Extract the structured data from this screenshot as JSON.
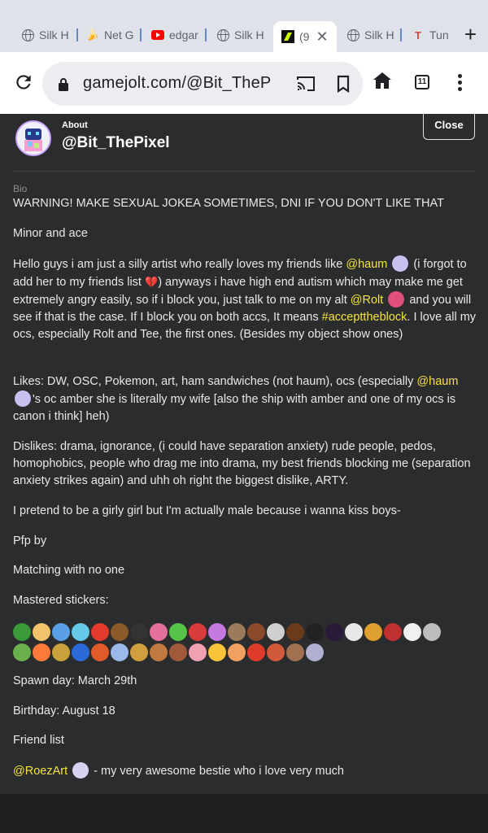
{
  "browser": {
    "tabs": [
      {
        "label": "Silk H",
        "icon": "globe-icon"
      },
      {
        "label": "Net G",
        "icon": "banana-icon"
      },
      {
        "label": "edgar",
        "icon": "youtube-icon"
      },
      {
        "label": "Silk H",
        "icon": "globe-icon"
      },
      {
        "label": "(9",
        "icon": "gamejolt-icon",
        "active": true
      },
      {
        "label": "Silk H",
        "icon": "globe-icon"
      },
      {
        "label": "Tun",
        "icon": "tumblr-icon"
      }
    ],
    "url": "gamejolt.com/@Bit_TheP",
    "tab_count": "11"
  },
  "modal": {
    "section": "About",
    "username": "@Bit_ThePixel",
    "close_label": "Close",
    "bio_label": "Bio",
    "lines": {
      "warning": "WARNING! MAKE SEXUAL JOKEA SOMETIMES, DNI IF YOU DON'T LIKE THAT",
      "minor": "Minor and ace",
      "p1a": "Hello guys i am just a silly artist who really loves my friends like ",
      "p1_mention1": "@haum",
      "p1b": " (i forgot to add her to my friends list ",
      "p1_emoji": "💔",
      "p1c": ") anyways i have high end autism which may make me get extremely angry easily, so if i block you, just talk to me on my alt ",
      "p1_mention2": "@Rolt",
      "p1d": " and you will see if that is the case. If I block you on both accs, It means ",
      "p1_hashtag": "#accepttheblock",
      "p1e": ". I love all my ocs, especially Rolt and Tee, the first ones. (Besides my object show ones)",
      "likes_a": "Likes: DW, OSC, Pokemon, art, ham sandwiches (not haum), ocs (especially ",
      "likes_mention": "@haum",
      "likes_b": "'s oc amber she is literally my wife [also the ship with amber and one of my ocs is canon i think] heh)",
      "dislikes": "Dislikes: drama, ignorance, (i could have separation anxiety) rude people, pedos, homophobics, people who drag me into drama, my best friends blocking me (separation anxiety strikes again) and uhh oh right the biggest dislike, ARTY.",
      "pretend": "I pretend to be a girly girl but I'm actually male because i wanna kiss boys-",
      "pfp": "Pfp by",
      "matching": "Matching with no one",
      "mastered": "Mastered stickers:",
      "spawn": "Spawn day: March 29th",
      "birthday": "Birthday: August 18",
      "friends": "Friend list",
      "bestie_mention": "@RoezArt",
      "bestie_text": " - my very awesome bestie who i love very much"
    },
    "stickers_row1": [
      "#3a9a3a",
      "#f3c36b",
      "#5aa0e6",
      "#66c9e8",
      "#e33b2e",
      "#8b5a2b",
      "#333333",
      "#e36f9c",
      "#57c24a",
      "#d93a3a",
      "#c479e0",
      "#9c7b5a",
      "#8a4a2a",
      "#cfcfcf",
      "#6a3a1a",
      "#222222",
      "#2a1a3a",
      "#e8e8e8",
      "#e0a030",
      "#c03030",
      "#f0f0f0",
      "#bdbdbd"
    ],
    "stickers_row2": [
      "#6ab04c",
      "#ff7a3a",
      "#c9a03a",
      "#2a6ad8",
      "#e05a2a",
      "#9ab8e8",
      "#d0a040",
      "#c07a40",
      "#a05a3a",
      "#f0a0b0",
      "#f8c43a",
      "#f0a060",
      "#e03a2a",
      "#d05a3a",
      "#a07050",
      "#b0b0d0"
    ]
  }
}
